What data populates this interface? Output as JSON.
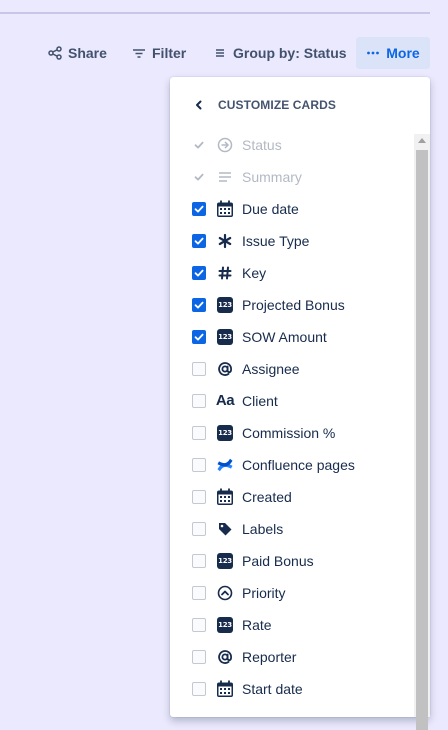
{
  "toolbar": {
    "share": "Share",
    "filter": "Filter",
    "group_by": "Group by: Status",
    "more": "More"
  },
  "panel": {
    "title": "CUSTOMIZE CARDS",
    "items": [
      {
        "label": "Status",
        "checked": true,
        "disabled": true,
        "icon": "arrow-circle-icon"
      },
      {
        "label": "Summary",
        "checked": true,
        "disabled": true,
        "icon": "text-lines-icon"
      },
      {
        "label": "Due date",
        "checked": true,
        "disabled": false,
        "icon": "calendar-icon"
      },
      {
        "label": "Issue Type",
        "checked": true,
        "disabled": false,
        "icon": "asterisk-icon"
      },
      {
        "label": "Key",
        "checked": true,
        "disabled": false,
        "icon": "hash-icon"
      },
      {
        "label": "Projected Bonus",
        "checked": true,
        "disabled": false,
        "icon": "number-icon"
      },
      {
        "label": "SOW Amount",
        "checked": true,
        "disabled": false,
        "icon": "number-icon"
      },
      {
        "label": "Assignee",
        "checked": false,
        "disabled": false,
        "icon": "at-icon"
      },
      {
        "label": "Client",
        "checked": false,
        "disabled": false,
        "icon": "text-field-icon"
      },
      {
        "label": "Commission %",
        "checked": false,
        "disabled": false,
        "icon": "number-icon"
      },
      {
        "label": "Confluence pages",
        "checked": false,
        "disabled": false,
        "icon": "confluence-icon"
      },
      {
        "label": "Created",
        "checked": false,
        "disabled": false,
        "icon": "calendar-icon"
      },
      {
        "label": "Labels",
        "checked": false,
        "disabled": false,
        "icon": "tag-icon"
      },
      {
        "label": "Paid Bonus",
        "checked": false,
        "disabled": false,
        "icon": "number-icon"
      },
      {
        "label": "Priority",
        "checked": false,
        "disabled": false,
        "icon": "priority-icon"
      },
      {
        "label": "Rate",
        "checked": false,
        "disabled": false,
        "icon": "number-icon"
      },
      {
        "label": "Reporter",
        "checked": false,
        "disabled": false,
        "icon": "at-icon"
      },
      {
        "label": "Start date",
        "checked": false,
        "disabled": false,
        "icon": "calendar-icon"
      }
    ]
  },
  "icons": {
    "number_badge_text": "123",
    "text_field_glyph": "Aa"
  },
  "colors": {
    "accent": "#0c66e4",
    "background": "#ebe9fd",
    "text": "#172b4d",
    "disabled_text": "#b3b9c4"
  }
}
